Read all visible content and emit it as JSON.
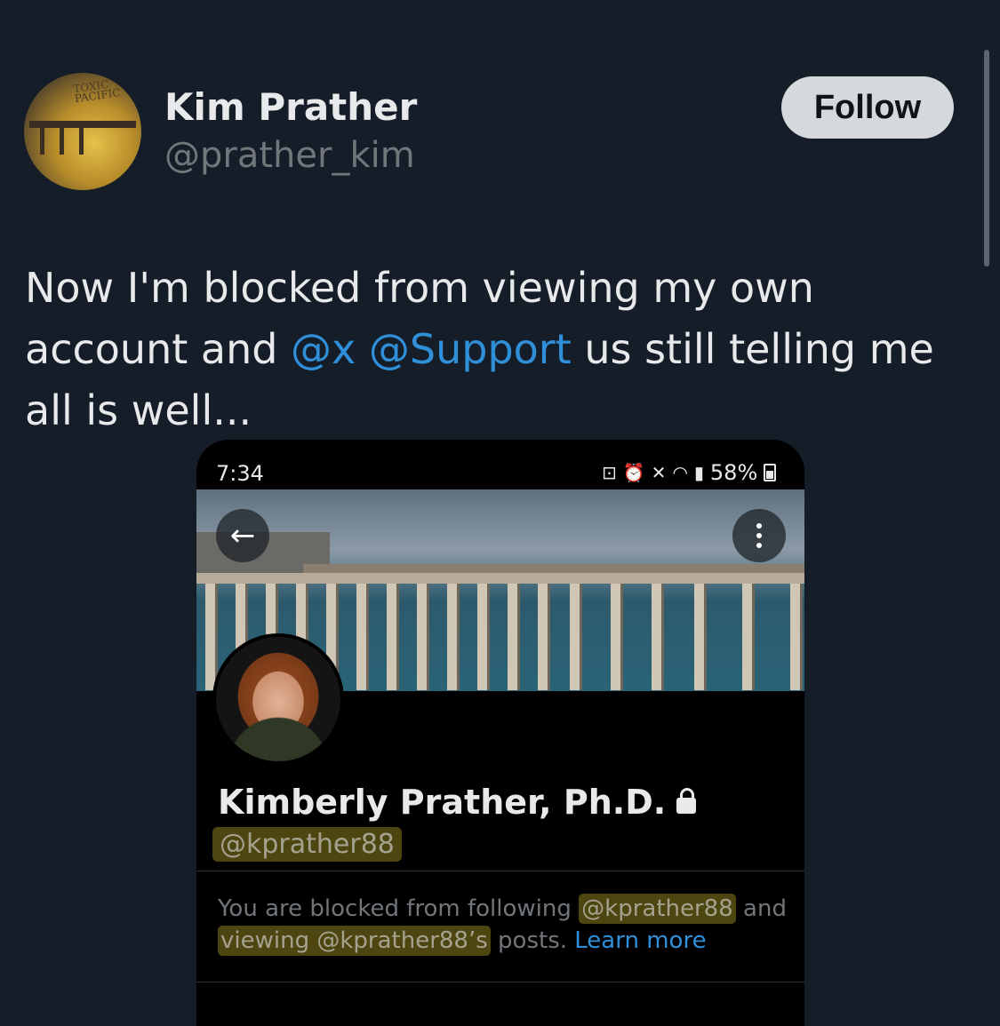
{
  "post": {
    "author_name": "Kim Prather",
    "author_handle": "@prather_kim",
    "follow_label": "Follow",
    "avatar_text": "TOXIC PACIFIC",
    "text_before": "Now I'm blocked from viewing my own account and ",
    "mention_1": "@x",
    "mention_2": "@Support",
    "text_after": " us still telling me all is well..."
  },
  "screenshot": {
    "time": "7:34",
    "battery": "58%",
    "back_icon": "←",
    "status_icons": [
      "screenshot-icon",
      "alarm-icon",
      "mute-icon",
      "wifi-icon",
      "signal-icon",
      "battery-icon"
    ],
    "profile_name": "Kimberly Prather, Ph.D.",
    "profile_handle": "@kprather88",
    "blocked_msg_1": "You are blocked from following ",
    "blocked_handle": "@kprather88",
    "blocked_msg_2": " and ",
    "blocked_viewing": "viewing @kprather88’s",
    "blocked_msg_3": " posts. ",
    "learn_more": "Learn more"
  },
  "colors": {
    "background": "#151d28",
    "mention": "#2f8fd9",
    "follow_bg": "#d6d9db",
    "highlight": "#4d4610"
  }
}
